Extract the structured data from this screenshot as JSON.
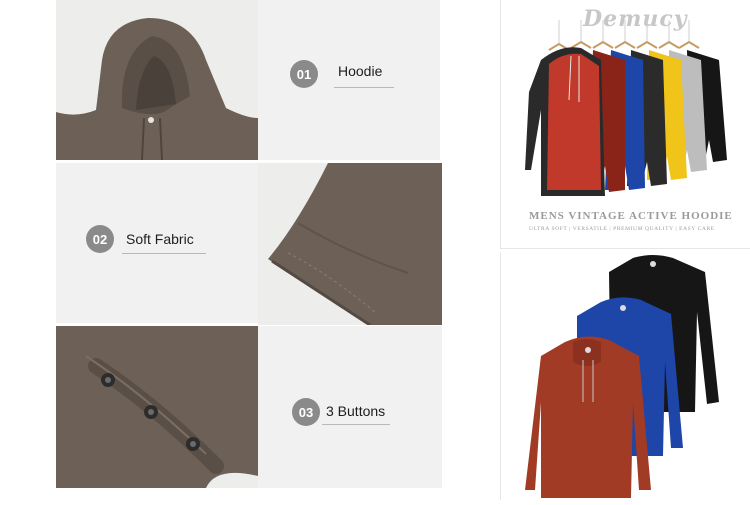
{
  "features": [
    {
      "number": "01",
      "label": "Hoodie"
    },
    {
      "number": "02",
      "label": "Soft Fabric"
    },
    {
      "number": "03",
      "label": "3 Buttons"
    }
  ],
  "product_panel": {
    "brand": "Demucy",
    "title": "MENS VINTAGE ACTIVE HOODIE",
    "subtitle": "ULTRA SOFT | VERSATILE | PREMIUM QUALITY | EASY CARE"
  },
  "colors": {
    "fabric_brown": "#6d6157",
    "rust": "#a23b26",
    "royal_blue": "#1d46a8",
    "black": "#161616",
    "yellow": "#f0c419",
    "light_gray": "#bdbdbd"
  },
  "icons": [
    "hanger-icon",
    "button-icon"
  ]
}
